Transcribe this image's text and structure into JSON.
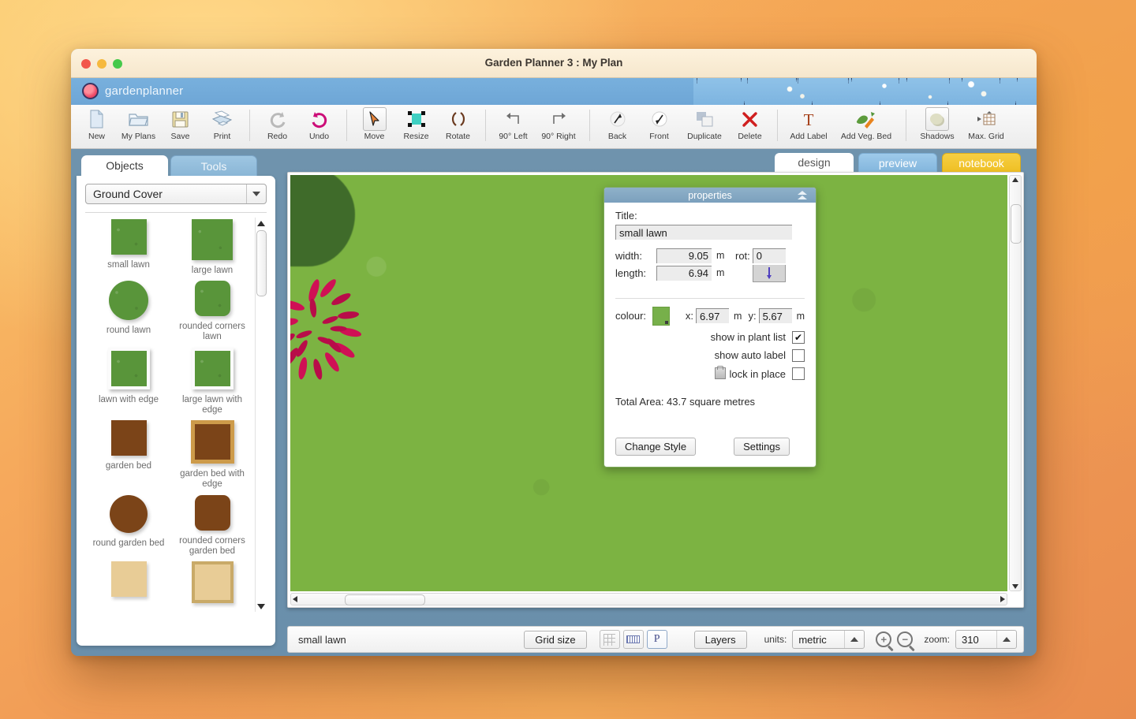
{
  "window": {
    "title": "Garden Planner 3 : My  Plan",
    "traffic_lights": [
      "close",
      "minimize",
      "zoom"
    ]
  },
  "banner": {
    "brand": "gardenplanner"
  },
  "toolbar": {
    "groups": [
      {
        "items": [
          {
            "label": "New",
            "icon": "new-document-icon"
          },
          {
            "label": "My Plans",
            "icon": "folder-icon"
          },
          {
            "label": "Save",
            "icon": "floppy-disk-icon"
          },
          {
            "label": "Print",
            "icon": "printer-icon"
          }
        ]
      },
      {
        "items": [
          {
            "label": "Redo",
            "icon": "redo-arrow-icon"
          },
          {
            "label": "Undo",
            "icon": "undo-arrow-icon"
          }
        ]
      },
      {
        "items": [
          {
            "label": "Move",
            "icon": "cursor-arrow-icon",
            "selected": true
          },
          {
            "label": "Resize",
            "icon": "resize-handles-icon"
          },
          {
            "label": "Rotate",
            "icon": "rotate-brackets-icon"
          }
        ]
      },
      {
        "items": [
          {
            "label": "90° Left",
            "icon": "rotate-left-icon"
          },
          {
            "label": "90° Right",
            "icon": "rotate-right-icon"
          }
        ]
      },
      {
        "items": [
          {
            "label": "Back",
            "icon": "send-back-icon"
          },
          {
            "label": "Front",
            "icon": "bring-front-icon"
          },
          {
            "label": "Duplicate",
            "icon": "duplicate-squares-icon"
          },
          {
            "label": "Delete",
            "icon": "delete-x-icon"
          }
        ]
      },
      {
        "items": [
          {
            "label": "Add Label",
            "icon": "text-t-icon"
          },
          {
            "label": "Add Veg. Bed",
            "icon": "vegetable-carrot-icon"
          }
        ]
      },
      {
        "items": [
          {
            "label": "Shadows",
            "icon": "shadow-sphere-icon"
          },
          {
            "label": "Max. Grid",
            "icon": "max-grid-icon"
          }
        ]
      }
    ]
  },
  "sidebar": {
    "tabs": [
      {
        "label": "Objects",
        "active": true
      },
      {
        "label": "Tools",
        "active": false
      }
    ],
    "category_select": {
      "value": "Ground Cover"
    },
    "objects": [
      {
        "label": "small lawn",
        "kind": "lawn"
      },
      {
        "label": "large lawn",
        "kind": "lawn-big"
      },
      {
        "label": "round lawn",
        "kind": "lawn-round"
      },
      {
        "label": "rounded corners lawn",
        "kind": "lawn-rounded"
      },
      {
        "label": "lawn with edge",
        "kind": "lawn-edge"
      },
      {
        "label": "large lawn with edge",
        "kind": "lawn-edge-big"
      },
      {
        "label": "garden bed",
        "kind": "bed"
      },
      {
        "label": "garden bed with edge",
        "kind": "bed-edge"
      },
      {
        "label": "round garden bed",
        "kind": "bed-round"
      },
      {
        "label": "rounded corners garden bed",
        "kind": "bed-rounded"
      },
      {
        "label": "",
        "kind": "sand"
      },
      {
        "label": "",
        "kind": "sand-edge"
      }
    ]
  },
  "view_tabs": [
    {
      "label": "design",
      "state": "active"
    },
    {
      "label": "preview",
      "state": "inactive"
    },
    {
      "label": "notebook",
      "state": "inactive"
    }
  ],
  "properties": {
    "panel_title": "properties",
    "title_label": "Title:",
    "title_value": "small lawn",
    "width_label": "width:",
    "width_value": "9.05",
    "width_unit": "m",
    "length_label": "length:",
    "length_value": "6.94",
    "length_unit": "m",
    "rot_label": "rot:",
    "rot_value": "0",
    "colour_label": "colour:",
    "colour_hex": "#77b04a",
    "x_label": "x:",
    "x_value": "6.97",
    "x_unit": "m",
    "y_label": "y:",
    "y_value": "5.67",
    "y_unit": "m",
    "show_in_plant_list_label": "show in plant list",
    "show_in_plant_list_checked": true,
    "show_auto_label_label": "show auto label",
    "show_auto_label_checked": false,
    "lock_in_place_label": "lock in place",
    "lock_in_place_checked": false,
    "total_area": "Total Area: 43.7 square metres",
    "change_style_label": "Change Style",
    "settings_label": "Settings",
    "checkmark": "✔"
  },
  "statusbar": {
    "selected_object": "small lawn",
    "grid_size_label": "Grid size",
    "toggles": [
      {
        "name": "grid-toggle",
        "on": false
      },
      {
        "name": "ruler-toggle",
        "on": false
      },
      {
        "name": "plant-labels-toggle",
        "on": true,
        "glyph": "P"
      }
    ],
    "layers_label": "Layers",
    "units_label": "units:",
    "units_value": "metric",
    "zoom_in_glyph": "+",
    "zoom_out_glyph": "−",
    "zoom_label": "zoom:",
    "zoom_value": "310"
  },
  "canvas": {
    "background_colour": "#7cb342",
    "objects": [
      {
        "name": "bush-shape",
        "colour": "#3f6b2a"
      },
      {
        "name": "red-flower-plant",
        "colour": "#cf1055"
      }
    ]
  }
}
